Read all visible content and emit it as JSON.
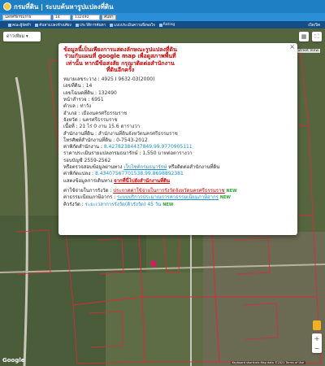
{
  "header": {
    "title": "กรมที่ดิน | ระบบค้นหารูปแปลงที่ดิน"
  },
  "search": {
    "province": "นครศรีธรรมราช",
    "district": "14",
    "parcel": "132490",
    "search_label": "ค้นหา"
  },
  "nav": {
    "items": [
      {
        "label": "คณะผู้จัดทำ",
        "icon": "info-icon"
      },
      {
        "label": "ค้นหาแปลงข้างเคียง",
        "icon": "search-icon"
      },
      {
        "label": "ประวัติการค้นหา",
        "icon": "history-icon"
      },
      {
        "label": "แบบประเมินความพึงพอใจ",
        "icon": "survey-icon"
      },
      {
        "label": "Rating",
        "icon": "star-icon"
      },
      {
        "label": "เปิด/ปิด",
        "icon": "toggle-icon"
      }
    ]
  },
  "map": {
    "type_label": "ดาวเทียม ▾",
    "street_view_label": "Toggle Street View",
    "google_label": "Google",
    "attribution": "Keyboard shortcuts  Map data ©2021  Terms of Use"
  },
  "popup": {
    "warning": "ข้อมูลนี้เป็นเพียงการแสดงลักษณะรูปแปลงที่ดินร่วมกับแผนที่ google map เพื่อดูสภาพพื้นที่เท่านั้น หากมีข้อสงสัย กรุณาติดต่อสำนักงานที่ดินอีกครั้ง",
    "rows": [
      {
        "label": "หมายเลขระวาง : ",
        "value": "4925 I 9632-03(2000)"
      },
      {
        "label": "เลขที่ดิน : ",
        "value": "14"
      },
      {
        "label": "เลขโฉนดที่ดิน : ",
        "value": "132490"
      },
      {
        "label": "หน้าสำรวจ : ",
        "value": "6951"
      },
      {
        "label": "ตำบล : ",
        "value": "ท่าวัง"
      },
      {
        "label": "อำเภอ : ",
        "value": "เมืองนครศรีธรรมราช"
      },
      {
        "label": "จังหวัด : ",
        "value": "นครศรีธรรมราช"
      },
      {
        "label": "เนื้อที่ : ",
        "value": "21 ไร่ 0 งาน 15.6 ตารางวา"
      },
      {
        "label": "สำนักงานที่ดิน : ",
        "value": "สำนักงานที่ดินจังหวัดนครศรีธรรมราช"
      },
      {
        "label": "โทรศัพท์สำนักงานที่ดิน : ",
        "value": "0-7543-2012"
      }
    ],
    "office_coord_label": "ค่าพิกัดสำนักงาน : ",
    "office_coord_value": "8.42782384437849,99.9770905111",
    "price_label": "ราคาประเมินรายแปลงกรมธนารักษ์ : ",
    "price_value": "1,550 บาทต่อตารางวา",
    "cycle_label": "รอบบัญชี ",
    "cycle_value": "2559-2562",
    "treasury_text": "หรือตรวจสอบข้อมูลผ่านทาง ",
    "treasury_link": "เว็บไซต์กรมธนารักษ์",
    "treasury_tail": " หรือติดต่อสำนักงานที่ดิน",
    "parcel_coord_label": "ค่าพิกัดแปลง : ",
    "parcel_coord_value": "8.43407567701538,99.8698892381",
    "disclaimer_label": "แสดงข้อมูลการเดินทาง ",
    "disclaimer_link": "จากที่นี่ไปยังสำนักงานที่ดิน",
    "fee_label": "ค่าใช้จ่ายในการรังวัด : ",
    "fee_link": "ประกาศค่าใช้จ่ายในการรังวัดจังหวัดนครศรีธรรมราช",
    "fee_tag": "NEW",
    "process_label": "ค่าธรรมเนียมภาษีอากร : ",
    "process_link": "ระบบบริการประมาณการค่าธรรมเนียมภาษีอากร",
    "process_tag": "NEW",
    "duration_label": "คิวรังวัด : ",
    "duration_value": "ระยะเวลาการรังวัด(คิวรังวัด) 45 วัน",
    "duration_tag": "NEW"
  },
  "colors": {
    "header": "#1e7fc4",
    "nav": "#154e86",
    "warning": "#d40000",
    "link": "#1a8fd8",
    "parcel_line": "#e0283a"
  }
}
